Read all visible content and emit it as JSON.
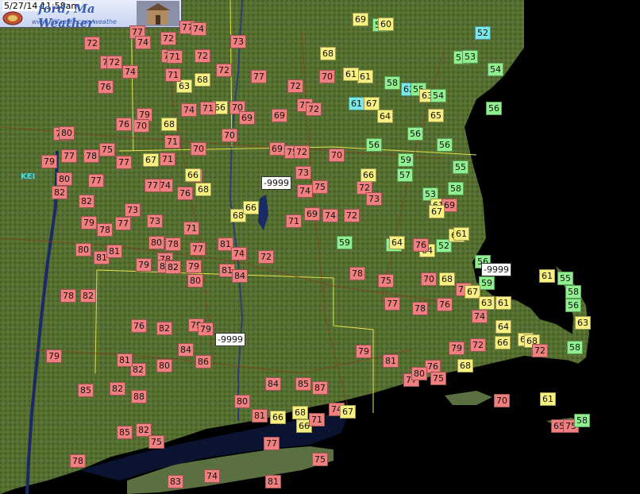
{
  "header": {
    "timestamp": "5/27/14 11:58am",
    "title_visible": "ford, Ma",
    "title_line2": "Weather",
    "url_visible": "www.PJlfamily.com/weathe"
  },
  "city_label": "KEI",
  "colors": {
    "land": "#4e6a2c",
    "water": "#0a1430",
    "hot_tag": "#f08080",
    "warm_tag": "#f8f080",
    "mild_tag": "#90f090",
    "cool_tag": "#7ae8e8",
    "missing_tag": "#ffffff",
    "state_border": "#e6e24a",
    "road": "#8b3a1a"
  },
  "legend_semantics": "Station readings are temperatures in degrees F; -9999 denotes missing data.",
  "stations": [
    {
      "label": "72",
      "tone": "red"
    },
    {
      "label": "77",
      "tone": "red"
    },
    {
      "label": "72",
      "tone": "red"
    },
    {
      "label": "77",
      "tone": "red"
    },
    {
      "label": "74",
      "tone": "red"
    },
    {
      "label": "73",
      "tone": "red"
    },
    {
      "label": "74",
      "tone": "red"
    },
    {
      "label": "72",
      "tone": "red"
    },
    {
      "label": "71",
      "tone": "red"
    },
    {
      "label": "72",
      "tone": "red"
    },
    {
      "label": "74",
      "tone": "red"
    },
    {
      "label": "72",
      "tone": "red"
    },
    {
      "label": "74",
      "tone": "red"
    },
    {
      "label": "76",
      "tone": "red"
    },
    {
      "label": "63",
      "tone": "yellow"
    },
    {
      "label": "68",
      "tone": "yellow"
    },
    {
      "label": "66",
      "tone": "yellow"
    },
    {
      "label": "70",
      "tone": "red"
    },
    {
      "label": "72",
      "tone": "red"
    },
    {
      "label": "71",
      "tone": "red"
    },
    {
      "label": "77",
      "tone": "red"
    },
    {
      "label": "72",
      "tone": "red"
    },
    {
      "label": "79",
      "tone": "red"
    },
    {
      "label": "76",
      "tone": "red"
    },
    {
      "label": "70",
      "tone": "red"
    },
    {
      "label": "68",
      "tone": "yellow"
    },
    {
      "label": "74",
      "tone": "red"
    },
    {
      "label": "71",
      "tone": "red"
    },
    {
      "label": "69",
      "tone": "red"
    },
    {
      "label": "69",
      "tone": "red"
    },
    {
      "label": "73",
      "tone": "red"
    },
    {
      "label": "72",
      "tone": "red"
    },
    {
      "label": "76",
      "tone": "red"
    },
    {
      "label": "80",
      "tone": "red"
    },
    {
      "label": "77",
      "tone": "red"
    },
    {
      "label": "78",
      "tone": "red"
    },
    {
      "label": "75",
      "tone": "red"
    },
    {
      "label": "79",
      "tone": "red"
    },
    {
      "label": "77",
      "tone": "red"
    },
    {
      "label": "71",
      "tone": "red"
    },
    {
      "label": "70",
      "tone": "red"
    },
    {
      "label": "70",
      "tone": "red"
    },
    {
      "label": "69",
      "tone": "red"
    },
    {
      "label": "75",
      "tone": "red"
    },
    {
      "label": "72",
      "tone": "red"
    },
    {
      "label": "70",
      "tone": "red"
    },
    {
      "label": "80",
      "tone": "red"
    },
    {
      "label": "77",
      "tone": "red"
    },
    {
      "label": "67",
      "tone": "yellow"
    },
    {
      "label": "71",
      "tone": "red"
    },
    {
      "label": "73",
      "tone": "red"
    },
    {
      "label": "74",
      "tone": "red"
    },
    {
      "label": "66",
      "tone": "yellow"
    },
    {
      "label": "73",
      "tone": "red"
    },
    {
      "label": "-9999",
      "tone": "white"
    },
    {
      "label": "82",
      "tone": "red"
    },
    {
      "label": "77",
      "tone": "red"
    },
    {
      "label": "76",
      "tone": "red"
    },
    {
      "label": "68",
      "tone": "yellow"
    },
    {
      "label": "72",
      "tone": "red"
    },
    {
      "label": "73",
      "tone": "red"
    },
    {
      "label": "75",
      "tone": "red"
    },
    {
      "label": "74",
      "tone": "red"
    },
    {
      "label": "72",
      "tone": "red"
    },
    {
      "label": "82",
      "tone": "red"
    },
    {
      "label": "73",
      "tone": "red"
    },
    {
      "label": "68",
      "tone": "yellow"
    },
    {
      "label": "66",
      "tone": "yellow"
    },
    {
      "label": "71",
      "tone": "red"
    },
    {
      "label": "69",
      "tone": "red"
    },
    {
      "label": "74",
      "tone": "red"
    },
    {
      "label": "79",
      "tone": "red"
    },
    {
      "label": "78",
      "tone": "red"
    },
    {
      "label": "77",
      "tone": "red"
    },
    {
      "label": "73",
      "tone": "red"
    },
    {
      "label": "71",
      "tone": "red"
    },
    {
      "label": "80",
      "tone": "red"
    },
    {
      "label": "78",
      "tone": "red"
    },
    {
      "label": "81",
      "tone": "red"
    },
    {
      "label": "77",
      "tone": "red"
    },
    {
      "label": "80",
      "tone": "red"
    },
    {
      "label": "74",
      "tone": "red"
    },
    {
      "label": "72",
      "tone": "red"
    },
    {
      "label": "79",
      "tone": "red"
    },
    {
      "label": "81",
      "tone": "red"
    },
    {
      "label": "78",
      "tone": "red"
    },
    {
      "label": "81",
      "tone": "red"
    },
    {
      "label": "82",
      "tone": "red"
    },
    {
      "label": "82",
      "tone": "red"
    },
    {
      "label": "79",
      "tone": "red"
    },
    {
      "label": "81",
      "tone": "red"
    },
    {
      "label": "78",
      "tone": "red"
    },
    {
      "label": "82",
      "tone": "red"
    },
    {
      "label": "80",
      "tone": "red"
    },
    {
      "label": "84",
      "tone": "red"
    },
    {
      "label": "-9999",
      "tone": "white"
    },
    {
      "label": "79",
      "tone": "red"
    },
    {
      "label": "76",
      "tone": "red"
    },
    {
      "label": "79",
      "tone": "red"
    },
    {
      "label": "82",
      "tone": "red"
    },
    {
      "label": "79",
      "tone": "red"
    },
    {
      "label": "86",
      "tone": "red"
    },
    {
      "label": "80",
      "tone": "red"
    },
    {
      "label": "82",
      "tone": "red"
    },
    {
      "label": "84",
      "tone": "red"
    },
    {
      "label": "81",
      "tone": "red"
    },
    {
      "label": "85",
      "tone": "red"
    },
    {
      "label": "82",
      "tone": "red"
    },
    {
      "label": "88",
      "tone": "red"
    },
    {
      "label": "80",
      "tone": "red"
    },
    {
      "label": "85",
      "tone": "red"
    },
    {
      "label": "82",
      "tone": "red"
    },
    {
      "label": "84",
      "tone": "red"
    },
    {
      "label": "85",
      "tone": "red"
    },
    {
      "label": "87",
      "tone": "red"
    },
    {
      "label": "81",
      "tone": "red"
    },
    {
      "label": "66",
      "tone": "yellow"
    },
    {
      "label": "68",
      "tone": "yellow"
    },
    {
      "label": "66",
      "tone": "yellow"
    },
    {
      "label": "71",
      "tone": "red"
    },
    {
      "label": "74",
      "tone": "red"
    },
    {
      "label": "67",
      "tone": "yellow"
    },
    {
      "label": "75",
      "tone": "red"
    },
    {
      "label": "78",
      "tone": "red"
    },
    {
      "label": "77",
      "tone": "red"
    },
    {
      "label": "75",
      "tone": "red"
    },
    {
      "label": "83",
      "tone": "red"
    },
    {
      "label": "74",
      "tone": "red"
    },
    {
      "label": "81",
      "tone": "red"
    },
    {
      "label": "69",
      "tone": "yellow"
    },
    {
      "label": "59",
      "tone": "green"
    },
    {
      "label": "60",
      "tone": "yellow"
    },
    {
      "label": "52",
      "tone": "cyan"
    },
    {
      "label": "68",
      "tone": "yellow"
    },
    {
      "label": "61",
      "tone": "yellow"
    },
    {
      "label": "58",
      "tone": "green"
    },
    {
      "label": "70",
      "tone": "red"
    },
    {
      "label": "61",
      "tone": "yellow"
    },
    {
      "label": "58",
      "tone": "green"
    },
    {
      "label": "53",
      "tone": "green"
    },
    {
      "label": "54",
      "tone": "green"
    },
    {
      "label": "62",
      "tone": "cyan"
    },
    {
      "label": "55",
      "tone": "green"
    },
    {
      "label": "56",
      "tone": "green"
    },
    {
      "label": "61",
      "tone": "cyan"
    },
    {
      "label": "67",
      "tone": "yellow"
    },
    {
      "label": "64",
      "tone": "yellow"
    },
    {
      "label": "63",
      "tone": "yellow"
    },
    {
      "label": "54",
      "tone": "green"
    },
    {
      "label": "56",
      "tone": "green"
    },
    {
      "label": "65",
      "tone": "yellow"
    },
    {
      "label": "56",
      "tone": "green"
    },
    {
      "label": "56",
      "tone": "green"
    },
    {
      "label": "55",
      "tone": "green"
    },
    {
      "label": "57",
      "tone": "green"
    },
    {
      "label": "66",
      "tone": "yellow"
    },
    {
      "label": "59",
      "tone": "green"
    },
    {
      "label": "58",
      "tone": "green"
    },
    {
      "label": "53",
      "tone": "green"
    },
    {
      "label": "61",
      "tone": "yellow"
    },
    {
      "label": "69",
      "tone": "red"
    },
    {
      "label": "64",
      "tone": "yellow"
    },
    {
      "label": "52",
      "tone": "green"
    },
    {
      "label": "61",
      "tone": "yellow"
    },
    {
      "label": "59",
      "tone": "green"
    },
    {
      "label": "56",
      "tone": "green"
    },
    {
      "label": "76",
      "tone": "red"
    },
    {
      "label": "67",
      "tone": "yellow"
    },
    {
      "label": "64",
      "tone": "yellow"
    },
    {
      "label": "61",
      "tone": "yellow"
    },
    {
      "label": "56",
      "tone": "green"
    },
    {
      "label": "-9999",
      "tone": "white"
    },
    {
      "label": "59",
      "tone": "green"
    },
    {
      "label": "78",
      "tone": "red"
    },
    {
      "label": "75",
      "tone": "red"
    },
    {
      "label": "70",
      "tone": "red"
    },
    {
      "label": "68",
      "tone": "yellow"
    },
    {
      "label": "73",
      "tone": "red"
    },
    {
      "label": "67",
      "tone": "yellow"
    },
    {
      "label": "63",
      "tone": "yellow"
    },
    {
      "label": "61",
      "tone": "yellow"
    },
    {
      "label": "61",
      "tone": "yellow"
    },
    {
      "label": "55",
      "tone": "green"
    },
    {
      "label": "58",
      "tone": "green"
    },
    {
      "label": "56",
      "tone": "green"
    },
    {
      "label": "63",
      "tone": "yellow"
    },
    {
      "label": "58",
      "tone": "green"
    },
    {
      "label": "77",
      "tone": "red"
    },
    {
      "label": "76",
      "tone": "red"
    },
    {
      "label": "78",
      "tone": "red"
    },
    {
      "label": "74",
      "tone": "red"
    },
    {
      "label": "64",
      "tone": "yellow"
    },
    {
      "label": "79",
      "tone": "red"
    },
    {
      "label": "72",
      "tone": "red"
    },
    {
      "label": "69",
      "tone": "yellow"
    },
    {
      "label": "68",
      "tone": "yellow"
    },
    {
      "label": "72",
      "tone": "red"
    },
    {
      "label": "66",
      "tone": "yellow"
    },
    {
      "label": "81",
      "tone": "red"
    },
    {
      "label": "76",
      "tone": "red"
    },
    {
      "label": "68",
      "tone": "yellow"
    },
    {
      "label": "77",
      "tone": "red"
    },
    {
      "label": "80",
      "tone": "red"
    },
    {
      "label": "75",
      "tone": "red"
    },
    {
      "label": "70",
      "tone": "red"
    },
    {
      "label": "61",
      "tone": "yellow"
    },
    {
      "label": "65",
      "tone": "red"
    },
    {
      "label": "75",
      "tone": "red"
    },
    {
      "label": "58",
      "tone": "green"
    },
    {
      "label": "79",
      "tone": "red"
    }
  ]
}
